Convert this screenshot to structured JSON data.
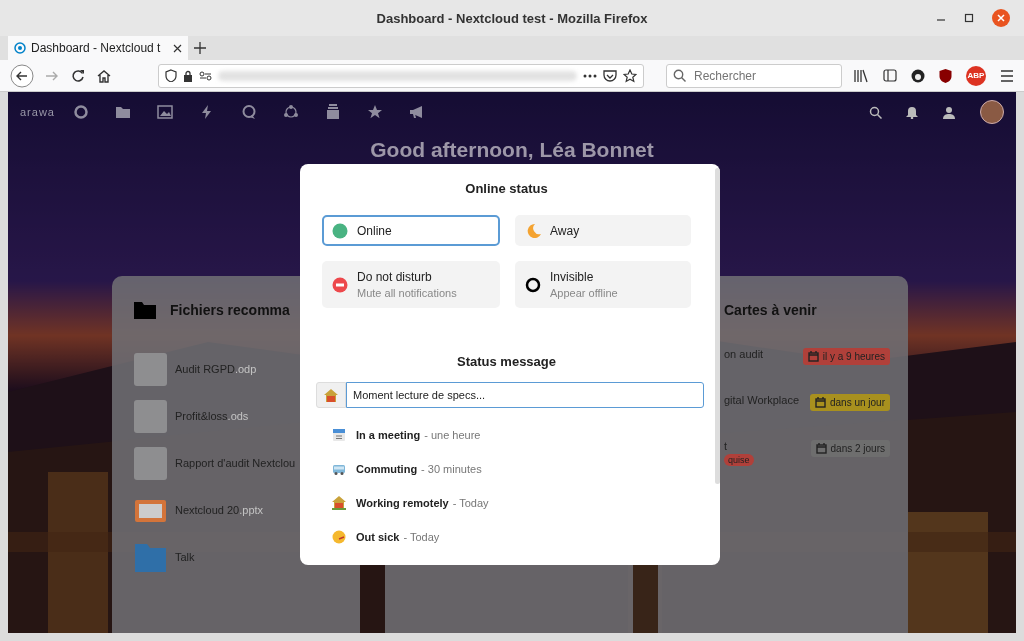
{
  "window": {
    "title": "Dashboard - Nextcloud test - Mozilla Firefox"
  },
  "tabs": [
    {
      "label": "Dashboard - Nextcloud t",
      "selected": true
    }
  ],
  "toolbar": {
    "search_placeholder": "Rechercher",
    "addon_badge": "ABP"
  },
  "app_header": {
    "logo": "arawa"
  },
  "greeting": "Good afternoon, Léa Bonnet",
  "recommended_files": {
    "title": "Fichiers recomma",
    "files": [
      {
        "name": "Audit RGPD",
        "ext": ".odp",
        "kind": "document"
      },
      {
        "name": "Profit&loss",
        "ext": ".ods",
        "kind": "blank"
      },
      {
        "name": "Rapport d'audit Nextclou",
        "kind": "blank"
      },
      {
        "name": "Nextcloud 20",
        "ext": ".pptx",
        "kind": "slides"
      },
      {
        "name": "Talk",
        "kind": "folder"
      }
    ]
  },
  "upcoming_cards": {
    "title": "Cartes à venir",
    "cards": [
      {
        "title": "on audit",
        "due": "il y a 9 heures",
        "color": "#b0403a"
      },
      {
        "title": "gital Workplace",
        "due": "dans un jour",
        "color": "#a8901e"
      },
      {
        "title": "t",
        "tag": "quise",
        "due": "dans 2 jours",
        "color": "#6e6e6e"
      }
    ]
  },
  "status_dialog": {
    "title": "Online status",
    "statuses": [
      {
        "kind": "online",
        "label": "Online",
        "selected": true
      },
      {
        "kind": "away",
        "label": "Away",
        "selected": false
      },
      {
        "kind": "dnd",
        "label": "Do not disturb",
        "subline": "Mute all notifications",
        "selected": false
      },
      {
        "kind": "invisible",
        "label": "Invisible",
        "subline": "Appear offline",
        "selected": false
      }
    ],
    "message_title": "Status message",
    "message_value": "Moment lecture de specs...",
    "predefined": [
      {
        "kind": "calendar",
        "label": "In a meeting",
        "clear": "- une heure"
      },
      {
        "kind": "bus",
        "label": "Commuting",
        "clear": "- 30 minutes"
      },
      {
        "kind": "house",
        "label": "Working remotely",
        "clear": "- Today"
      },
      {
        "kind": "sick",
        "label": "Out sick",
        "clear": "- Today"
      }
    ]
  }
}
